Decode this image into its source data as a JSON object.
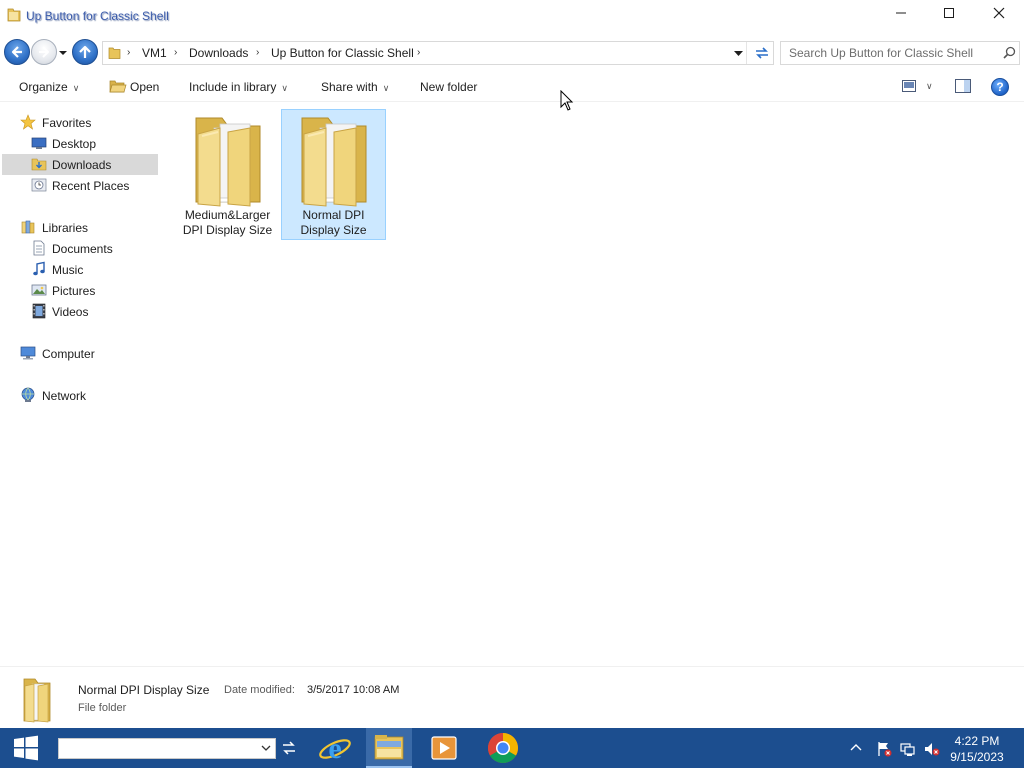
{
  "window": {
    "title": "Up Button for Classic Shell"
  },
  "navigation": {
    "breadcrumbs": [
      "VM1",
      "Downloads",
      "Up Button for Classic Shell"
    ],
    "search_placeholder": "Search Up Button for Classic Shell"
  },
  "toolbar": {
    "organize": "Organize",
    "open": "Open",
    "include_in_library": "Include in library",
    "share_with": "Share with",
    "new_folder": "New folder"
  },
  "sidebar": {
    "favorites": {
      "label": "Favorites",
      "items": [
        {
          "label": "Desktop",
          "icon": "desktop-icon"
        },
        {
          "label": "Downloads",
          "icon": "downloads-icon",
          "selected": true
        },
        {
          "label": "Recent Places",
          "icon": "recent-places-icon"
        }
      ]
    },
    "libraries": {
      "label": "Libraries",
      "items": [
        {
          "label": "Documents",
          "icon": "documents-icon"
        },
        {
          "label": "Music",
          "icon": "music-icon"
        },
        {
          "label": "Pictures",
          "icon": "pictures-icon"
        },
        {
          "label": "Videos",
          "icon": "videos-icon"
        }
      ]
    },
    "computer": "Computer",
    "network": "Network"
  },
  "content": {
    "items": [
      {
        "line1": "Medium&Larger",
        "line2": "DPI Display Size",
        "selected": false
      },
      {
        "line1": "Normal DPI",
        "line2": "Display Size",
        "selected": true
      }
    ]
  },
  "details": {
    "name": "Normal DPI Display Size",
    "date_label": "Date modified:",
    "date_value": "3/5/2017 10:08 AM",
    "type": "File folder"
  },
  "taskbar": {
    "apps": [
      "internet-explorer-icon",
      "file-explorer-icon",
      "media-player-icon",
      "chrome-icon"
    ],
    "time": "4:22 PM",
    "date": "9/15/2023"
  },
  "colors": {
    "taskbar": "#1c4e8f",
    "selection": "#cce8ff",
    "selection_border": "#99d1ff",
    "nav_selected": "#d9d9d9"
  }
}
